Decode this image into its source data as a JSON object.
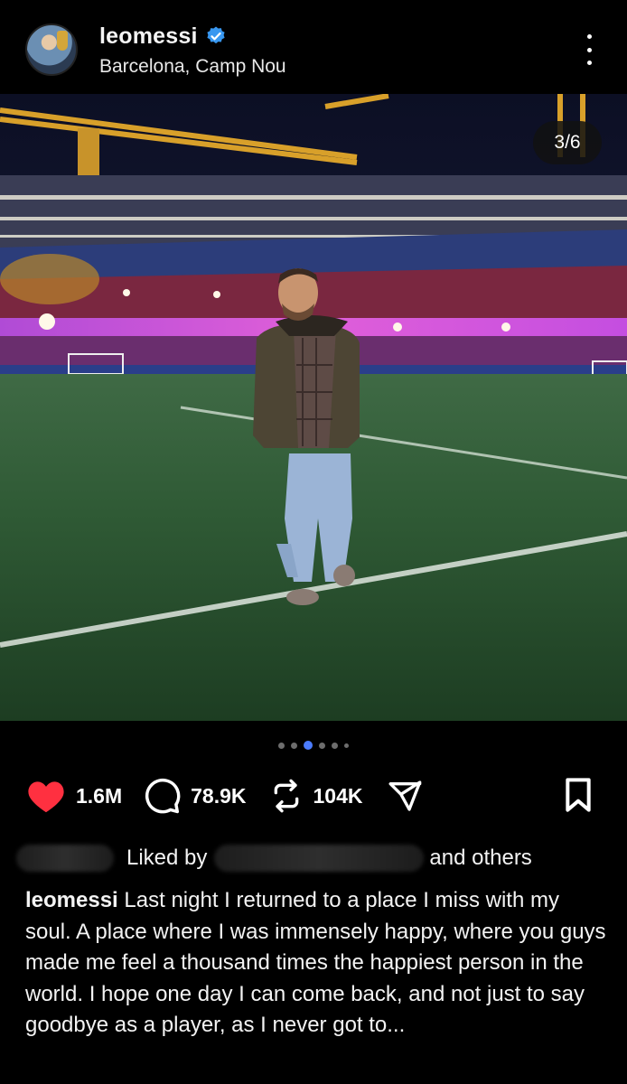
{
  "post": {
    "username": "leomessi",
    "location": "Barcelona, Camp Nou",
    "verified": true,
    "image_counter": "3/6",
    "carousel_active_index": 2,
    "carousel_dot_count": 6
  },
  "actions": {
    "likes": "1.6M",
    "comments": "78.9K",
    "reposts": "104K"
  },
  "liked_by": {
    "prefix": "Liked by",
    "suffix": "and others"
  },
  "caption": {
    "author": "leomessi",
    "text": "Last night I returned to a place I miss with my soul. A place where I was immensely happy, where you guys made me feel a thousand times the happiest person in the world. I hope one day I can come back, and not just to say goodbye as a player, as I never got to..."
  },
  "colors": {
    "background": "#000000",
    "like_heart": "#ff3040",
    "verified_badge": "#3897f0",
    "active_dot": "#4b7cff"
  }
}
